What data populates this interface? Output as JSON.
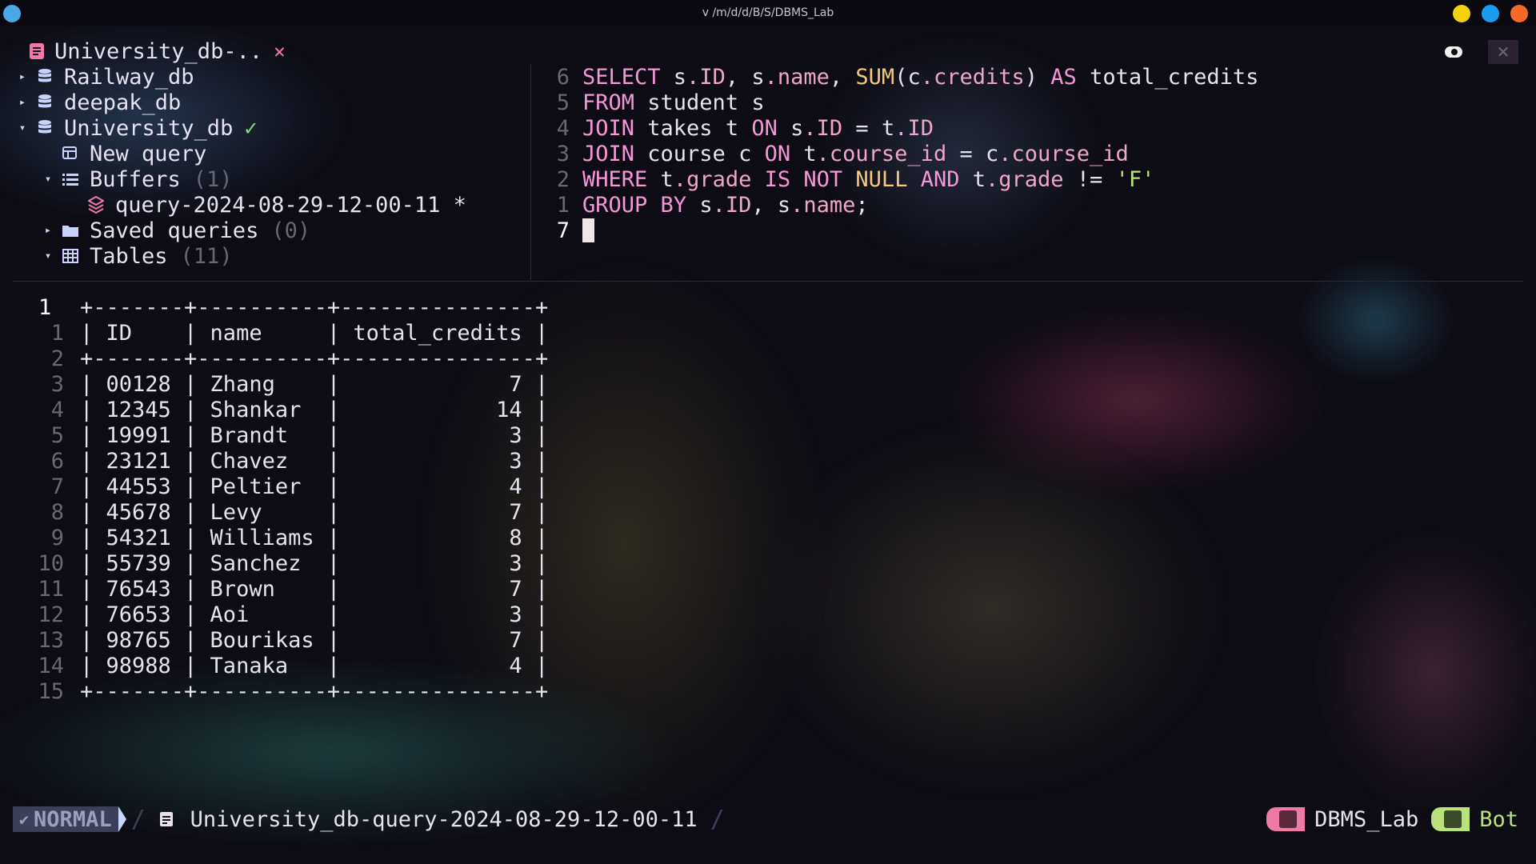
{
  "window": {
    "title": "v /m/d/d/B/S/DBMS_Lab"
  },
  "colors": {
    "accent_pink": "#f597d6",
    "keyword": "#f597d6",
    "function": "#f5c97a",
    "identifier": "#f0a6c8",
    "string": "#b9e37a",
    "ok_green": "#7ee07a"
  },
  "sidebar": {
    "tab_title": "University_db-..",
    "tab_close": "✕",
    "items": [
      {
        "arrow": "▸",
        "icon": "database-icon",
        "label": "Railway_db"
      },
      {
        "arrow": "▸",
        "icon": "database-icon",
        "label": "deepak_db"
      },
      {
        "arrow": "▾",
        "icon": "database-icon",
        "label": "University_db",
        "status": "✓"
      },
      {
        "arrow": "",
        "icon": "new-query-icon",
        "label": "New query"
      },
      {
        "arrow": "▾",
        "icon": "list-icon",
        "label": "Buffers",
        "count": "(1)"
      },
      {
        "arrow": "",
        "icon": "layers-icon",
        "label": "query-2024-08-29-12-00-11 *"
      },
      {
        "arrow": "▸",
        "icon": "folder-icon",
        "label": "Saved queries",
        "count": "(0)"
      },
      {
        "arrow": "▾",
        "icon": "table-icon",
        "label": "Tables",
        "count": "(11)"
      }
    ]
  },
  "editor": {
    "line_numbers": [
      "6",
      "5",
      "4",
      "3",
      "2",
      "1",
      "7"
    ],
    "lines": [
      [
        {
          "t": "SELECT ",
          "c": "kw"
        },
        {
          "t": "s",
          "c": "pl"
        },
        {
          "t": ".ID",
          "c": "id"
        },
        {
          "t": ", ",
          "c": "pl"
        },
        {
          "t": "s",
          "c": "pl"
        },
        {
          "t": ".name",
          "c": "id"
        },
        {
          "t": ", ",
          "c": "pl"
        },
        {
          "t": "SUM",
          "c": "fn"
        },
        {
          "t": "(",
          "c": "pl"
        },
        {
          "t": "c",
          "c": "pl"
        },
        {
          "t": ".credits",
          "c": "id"
        },
        {
          "t": ") ",
          "c": "pl"
        },
        {
          "t": "AS ",
          "c": "kw"
        },
        {
          "t": "total_credits",
          "c": "pl"
        }
      ],
      [
        {
          "t": "FROM ",
          "c": "kw"
        },
        {
          "t": "student s",
          "c": "pl"
        }
      ],
      [
        {
          "t": "JOIN ",
          "c": "kw"
        },
        {
          "t": "takes t ",
          "c": "pl"
        },
        {
          "t": "ON ",
          "c": "kw"
        },
        {
          "t": "s",
          "c": "pl"
        },
        {
          "t": ".ID",
          "c": "id"
        },
        {
          "t": " = ",
          "c": "pl"
        },
        {
          "t": "t",
          "c": "pl"
        },
        {
          "t": ".ID",
          "c": "id"
        }
      ],
      [
        {
          "t": "JOIN ",
          "c": "kw"
        },
        {
          "t": "course c ",
          "c": "pl"
        },
        {
          "t": "ON ",
          "c": "kw"
        },
        {
          "t": "t",
          "c": "pl"
        },
        {
          "t": ".course_id",
          "c": "id"
        },
        {
          "t": " = ",
          "c": "pl"
        },
        {
          "t": "c",
          "c": "pl"
        },
        {
          "t": ".course_id",
          "c": "id"
        }
      ],
      [
        {
          "t": "WHERE ",
          "c": "kw"
        },
        {
          "t": "t",
          "c": "pl"
        },
        {
          "t": ".grade",
          "c": "id"
        },
        {
          "t": " ",
          "c": "pl"
        },
        {
          "t": "IS NOT ",
          "c": "kw"
        },
        {
          "t": "NULL ",
          "c": "fn"
        },
        {
          "t": "AND ",
          "c": "kw"
        },
        {
          "t": "t",
          "c": "pl"
        },
        {
          "t": ".grade",
          "c": "id"
        },
        {
          "t": " != ",
          "c": "pl"
        },
        {
          "t": "'F'",
          "c": "str"
        }
      ],
      [
        {
          "t": "GROUP BY ",
          "c": "kw"
        },
        {
          "t": "s",
          "c": "pl"
        },
        {
          "t": ".ID",
          "c": "id"
        },
        {
          "t": ", ",
          "c": "pl"
        },
        {
          "t": "s",
          "c": "pl"
        },
        {
          "t": ".name",
          "c": "id"
        },
        {
          "t": ";",
          "c": "pl"
        }
      ],
      []
    ]
  },
  "results": {
    "line_numbers": [
      "1",
      "1",
      "2",
      "3",
      "4",
      "5",
      "6",
      "7",
      "8",
      "9",
      "10",
      "11",
      "12",
      "13",
      "14",
      "15"
    ],
    "lines": [
      "+-------+----------+---------------+",
      "| ID    | name     | total_credits |",
      "+-------+----------+---------------+",
      "| 00128 | Zhang    |             7 |",
      "| 12345 | Shankar  |            14 |",
      "| 19991 | Brandt   |             3 |",
      "| 23121 | Chavez   |             3 |",
      "| 44553 | Peltier  |             4 |",
      "| 45678 | Levy     |             7 |",
      "| 54321 | Williams |             8 |",
      "| 55739 | Sanchez  |             3 |",
      "| 76543 | Brown    |             7 |",
      "| 76653 | Aoi      |             3 |",
      "| 98765 | Bourikas |             7 |",
      "| 98988 | Tanaka   |             4 |",
      "+-------+----------+---------------+"
    ]
  },
  "statusbar": {
    "mode": "NORMAL",
    "filename": "University_db-query-2024-08-29-12-00-11",
    "project": "DBMS_Lab",
    "position": "Bot"
  }
}
